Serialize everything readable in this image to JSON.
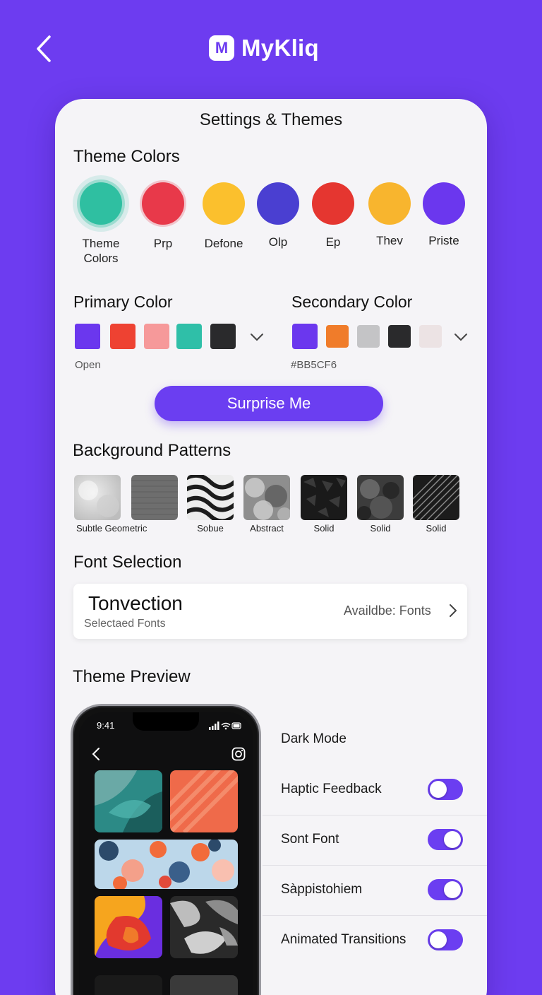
{
  "app": {
    "logo_letter": "M",
    "name": "MyKliq"
  },
  "card": {
    "title": "Settings & Themes"
  },
  "theme_colors": {
    "title": "Theme Colors",
    "items": [
      {
        "label": "Theme\nColors",
        "color": "#2fbfa1",
        "selected": true
      },
      {
        "label": "Prp",
        "color": "#e8394a",
        "selected": false
      },
      {
        "label": "Defone",
        "color": "#fbc02d",
        "selected": false
      },
      {
        "label": "Olp",
        "color": "#4a3fd1",
        "selected": false
      },
      {
        "label": "Ep",
        "color": "#e53630",
        "selected": false
      },
      {
        "label": "Thev",
        "color": "#f8b52e",
        "selected": false
      },
      {
        "label": "Priste",
        "color": "#6b37ee",
        "selected": false
      }
    ]
  },
  "primary_color": {
    "title": "Primary Color",
    "swatches": [
      "#6b37ee",
      "#ee4232",
      "#f6999a",
      "#2fbfa8",
      "#2a2a2c"
    ],
    "caption": "Open"
  },
  "secondary_color": {
    "title": "Secondary Color",
    "swatches": [
      "#6b37ee",
      "#f07c2a",
      "#c4c4c6",
      "#2a2a2c",
      "#ece3e4"
    ],
    "caption": "#BB5CF6"
  },
  "surprise_button": {
    "label": "Surprise Me"
  },
  "background_patterns": {
    "title": "Background Patterns",
    "items": [
      {
        "label": "Subtle Geometric",
        "style": "light-marble"
      },
      {
        "label": "",
        "style": "grey-texture"
      },
      {
        "label": "Sobue",
        "style": "wave-stripes"
      },
      {
        "label": "Abstract",
        "style": "grey-clouds"
      },
      {
        "label": "Solid",
        "style": "dark-geometric"
      },
      {
        "label": "Solid",
        "style": "dark-clouds"
      },
      {
        "label": "Solid",
        "style": "diagonal-stripes"
      }
    ]
  },
  "font_selection": {
    "title": "Font Selection",
    "font_name": "Tonvection",
    "subtitle": "Selectaed Fonts",
    "available_label": "Availdbe: Fonts"
  },
  "theme_preview": {
    "title": "Theme Preview",
    "phone": {
      "time": "9:41"
    }
  },
  "settings": [
    {
      "label": "Dark Mode",
      "has_toggle": false
    },
    {
      "label": "Haptic Feedback",
      "has_toggle": true,
      "on": false
    },
    {
      "label": "Sont Font",
      "has_toggle": true,
      "on": true
    },
    {
      "label": "Sàppistohiem",
      "has_toggle": true,
      "on": true
    },
    {
      "label": "Animated Transitions",
      "has_toggle": true,
      "on": false
    }
  ]
}
